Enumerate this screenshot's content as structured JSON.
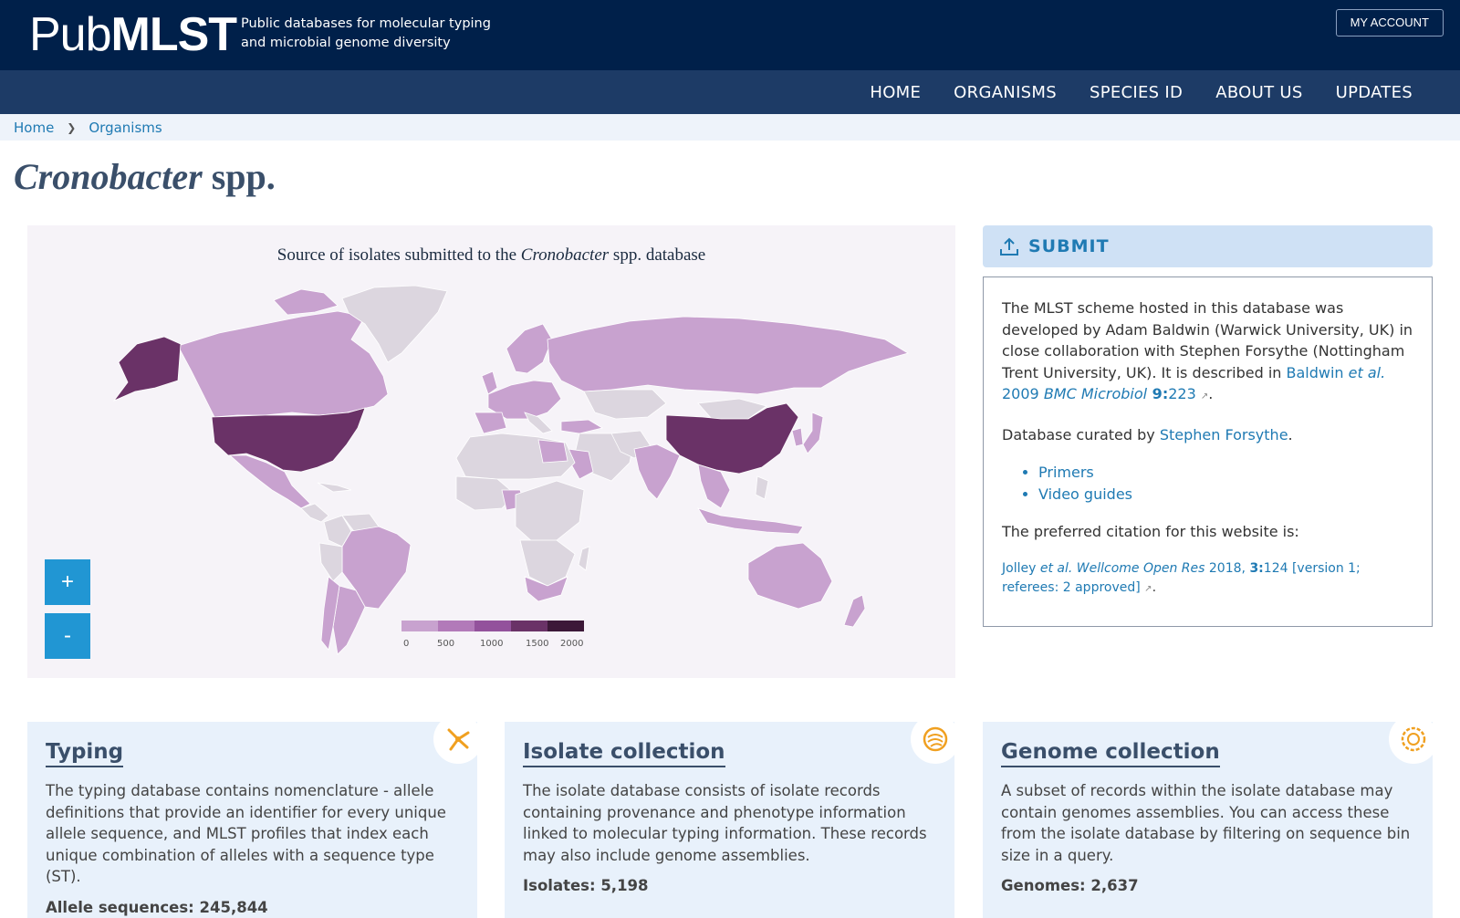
{
  "header": {
    "logo_light": "Pub",
    "logo_bold": "MLST",
    "tagline_line1": "Public databases for molecular typing",
    "tagline_line2": "and microbial genome diversity",
    "account_label": "MY ACCOUNT"
  },
  "nav": {
    "items": [
      {
        "label": "HOME"
      },
      {
        "label": "ORGANISMS"
      },
      {
        "label": "SPECIES ID"
      },
      {
        "label": "ABOUT US"
      },
      {
        "label": "UPDATES"
      }
    ]
  },
  "breadcrumb": {
    "home": "Home",
    "organisms": "Organisms"
  },
  "page": {
    "title_genus": "Cronobacter",
    "title_suffix": " spp."
  },
  "map": {
    "caption_prefix": "Source of isolates submitted to the ",
    "caption_genus": "Cronobacter",
    "caption_suffix": " spp. database",
    "zoom_in": "+",
    "zoom_out": "-",
    "legend_ticks": [
      "0",
      "500",
      "1000",
      "1500",
      "2000"
    ],
    "colors": {
      "none": "#dcd6df",
      "low": "#c8a2cf",
      "high": "#6a3267",
      "ocean": "#f6f3f8"
    },
    "legend_colors": [
      "#c8a2cf",
      "#b27ab9",
      "#93529c",
      "#6a3267",
      "#3c1838"
    ]
  },
  "submit": {
    "label": "SUBMIT",
    "icon": "upload-icon"
  },
  "side": {
    "p1_text": "The MLST scheme hosted in this database was developed by Adam Baldwin (Warwick University, UK) in close collaboration with Stephen Forsythe (Nottingham Trent University, UK). It is described in ",
    "p1_link_author": "Baldwin ",
    "p1_link_etal": "et al.",
    "p1_link_year": " 2009 ",
    "p1_link_journal": "BMC Microbiol",
    "p1_link_vol": " 9:",
    "p1_link_page": "223",
    "p2_text": "Database curated by ",
    "p2_link": "Stephen Forsythe",
    "links": [
      "Primers",
      "Video guides"
    ],
    "citation_intro": "The preferred citation for this website is:",
    "cite_author": "Jolley ",
    "cite_etal": "et al.",
    "cite_journal": " Wellcome Open Res",
    "cite_year": " 2018, ",
    "cite_vol": "3:",
    "cite_rest": "124 [version 1; referees: 2 approved]"
  },
  "cards": [
    {
      "title": "Typing",
      "text": "The typing database contains nomenclature - allele definitions that provide an identifier for every unique allele sequence, and MLST profiles that index each unique combination of alleles with a sequence type (ST).",
      "stat": "Allele sequences: 245,844",
      "icon": "typing-icon"
    },
    {
      "title": "Isolate collection",
      "text": "The isolate database consists of isolate records containing provenance and phenotype information linked to molecular typing information. These records may also include genome assemblies.",
      "stat": "Isolates: 5,198",
      "icon": "bacteria-icon"
    },
    {
      "title": "Genome collection",
      "text": "A subset of records within the isolate database may contain genomes assemblies. You can access these from the isolate database by filtering on sequence bin size in a query.",
      "stat": "Genomes: 2,637",
      "icon": "genome-icon"
    }
  ]
}
